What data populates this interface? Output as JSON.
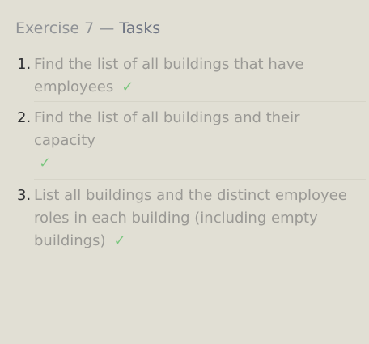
{
  "header": {
    "exercise_label": "Exercise 7",
    "separator": "—",
    "tasks_label": "Tasks"
  },
  "tasks": [
    {
      "number": "1.",
      "text": "Find the list of all buildings that have employees",
      "status_icon": "check-icon",
      "status_glyph": "✓",
      "status_color": "#7bc77f"
    },
    {
      "number": "2.",
      "text": "Find the list of all buildings and their capacity",
      "status_icon": "check-icon",
      "status_glyph": "✓",
      "status_color": "#7bc77f"
    },
    {
      "number": "3.",
      "text": "List all buildings and the distinct employee roles in each building (including empty buildings)",
      "status_icon": "check-icon",
      "status_glyph": "✓",
      "status_color": "#7bc77f"
    }
  ],
  "colors": {
    "background": "#e1dfd4",
    "task_text": "#9a9995",
    "number_text": "#2f3033",
    "header_text": "#6f7584",
    "divider": "#d6d4c8",
    "success": "#7bc77f"
  }
}
